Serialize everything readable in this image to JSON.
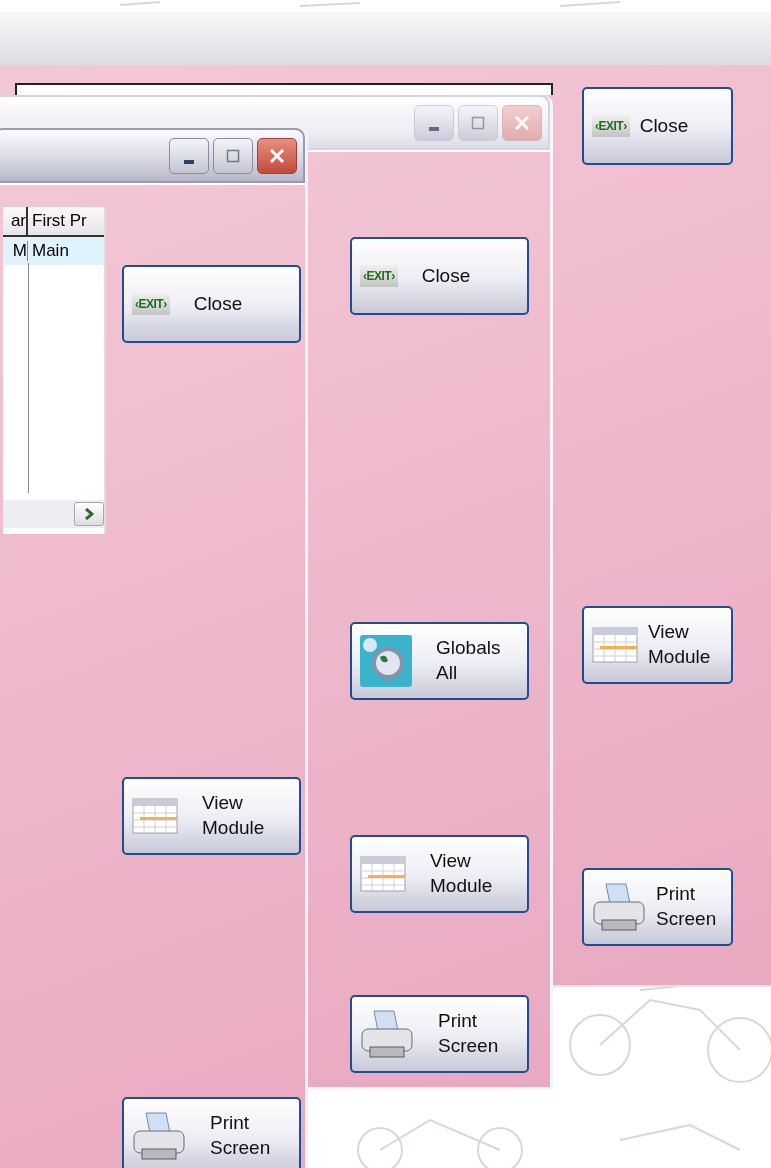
{
  "background_window": {
    "buttons": [
      {
        "kind": "exit",
        "sign": "‹EXIT›",
        "label": "Close"
      },
      {
        "kind": "module",
        "label": "View Module"
      },
      {
        "kind": "print",
        "label": "Print Screen"
      }
    ]
  },
  "windows": [
    {
      "active": false,
      "buttons": [
        {
          "kind": "exit",
          "sign": "‹EXIT›",
          "label": "Close"
        },
        {
          "kind": "globe",
          "label": "Globals All"
        },
        {
          "kind": "module",
          "label": "View Module"
        },
        {
          "kind": "print",
          "label": "Print Screen"
        }
      ]
    },
    {
      "active": true,
      "grid": {
        "columns": [
          "ar",
          "First Pr"
        ],
        "rows": [
          {
            "cells": [
              "M",
              "Main"
            ],
            "selected": true
          }
        ]
      },
      "buttons": [
        {
          "kind": "exit",
          "sign": "‹EXIT›",
          "label": "Close"
        },
        {
          "kind": "module",
          "label": "View Module"
        },
        {
          "kind": "print",
          "label": "Print Screen"
        }
      ]
    }
  ]
}
